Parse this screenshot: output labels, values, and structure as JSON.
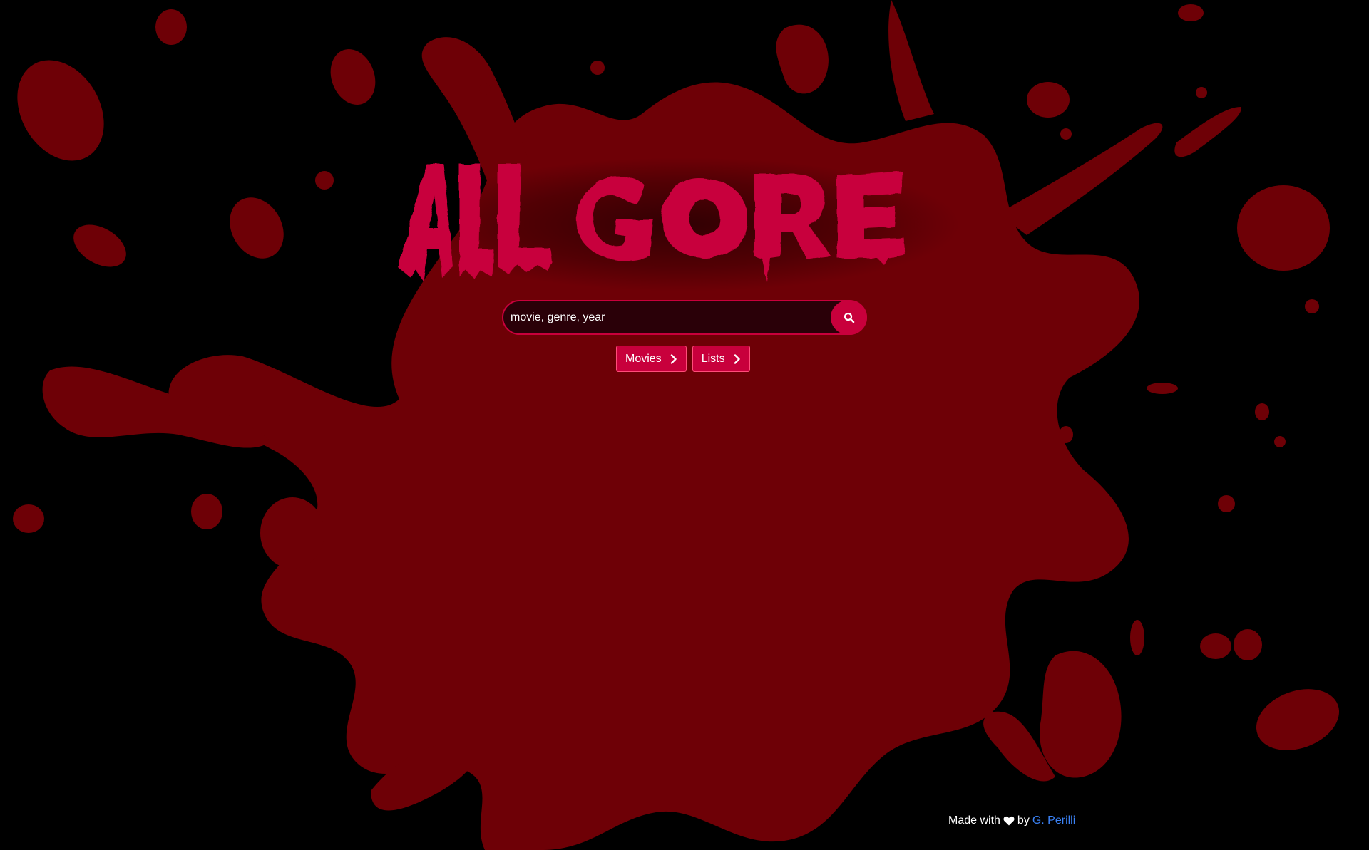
{
  "brand": {
    "logo_text": "ALL GORE",
    "logo_color": "#c8003c"
  },
  "search": {
    "placeholder": "movie, genre, year",
    "button_icon": "search-icon"
  },
  "nav": {
    "items": [
      {
        "label": "Movies",
        "icon": "chevron-right-icon"
      },
      {
        "label": "Lists",
        "icon": "chevron-right-icon"
      }
    ]
  },
  "footer": {
    "made_with": "Made with",
    "heart_icon": "heart-icon",
    "by": "by",
    "author": "G. Perilli"
  },
  "colors": {
    "background": "#000000",
    "splatter": "#6e0006",
    "accent": "#c8003c",
    "link": "#3b82f6"
  }
}
